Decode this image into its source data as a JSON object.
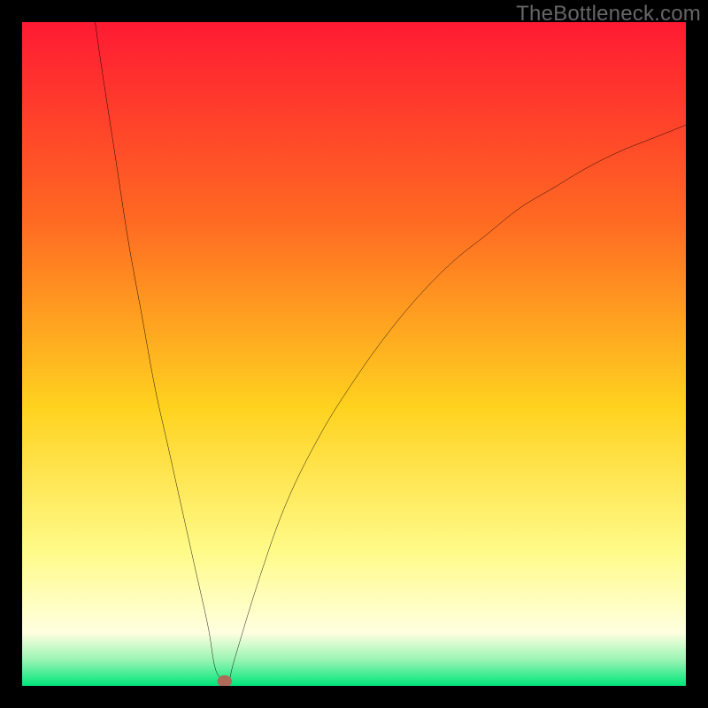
{
  "watermark": "TheBottleneck.com",
  "colors": {
    "gradient_top": "#ff1a33",
    "gradient_mid1": "#ff6a22",
    "gradient_mid2": "#ffd21f",
    "gradient_mid3": "#fffb8a",
    "gradient_mid4": "#ffffe0",
    "gradient_low": "#9cf5b4",
    "gradient_bottom": "#00e57a",
    "curve": "#000000",
    "marker": "#b06a5a",
    "frame": "#000000"
  },
  "chart_data": {
    "type": "line",
    "title": "",
    "xlabel": "",
    "ylabel": "",
    "xlim": [
      0,
      100
    ],
    "ylim": [
      0,
      100
    ],
    "y_axis_note": "background gradient encodes severity: 0 is green (good), 100 is red (bad)",
    "series": [
      {
        "name": "curve",
        "x": [
          11,
          12,
          14,
          16,
          18,
          20,
          22,
          24,
          26,
          28,
          29,
          30,
          31,
          32,
          36,
          40,
          45,
          50,
          55,
          60,
          65,
          70,
          75,
          80,
          85,
          90,
          95,
          100
        ],
        "values": [
          100,
          93,
          80,
          67,
          56,
          45,
          36,
          27,
          18,
          9,
          3,
          1,
          0,
          4,
          17,
          28,
          38,
          46,
          53,
          59,
          64,
          68,
          72,
          75,
          78,
          80.5,
          82.5,
          84.5
        ]
      }
    ],
    "marker": {
      "name": "current-point",
      "x": 30.5,
      "y": 0.7
    }
  }
}
